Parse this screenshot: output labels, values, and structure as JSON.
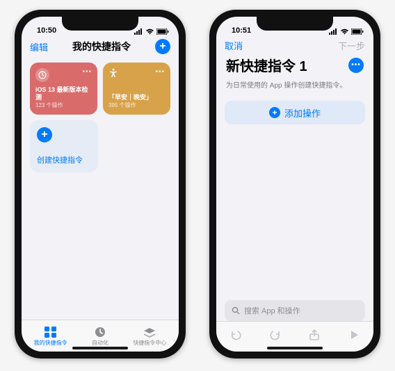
{
  "left": {
    "status_time": "10:50",
    "header_edit": "编辑",
    "header_title": "我的快捷指令",
    "card1": {
      "title": "iOS 13 最新版本检测",
      "sub": "123 个操作",
      "icon": "clock-icon"
    },
    "card2": {
      "title": "「早安｜晚安」",
      "sub": "395 个操作",
      "icon": "accessibility-icon"
    },
    "create_label": "创建快捷指令",
    "tabs": {
      "my": "我的快捷指令",
      "auto": "自动化",
      "center": "快捷指令中心"
    }
  },
  "right": {
    "status_time": "10:51",
    "cancel": "取消",
    "next": "下一步",
    "title": "新快捷指令 1",
    "subtitle": "为日常使用的 App 操作创建快捷指令。",
    "add_action": "添加操作",
    "search_placeholder": "搜索 App 和操作"
  }
}
